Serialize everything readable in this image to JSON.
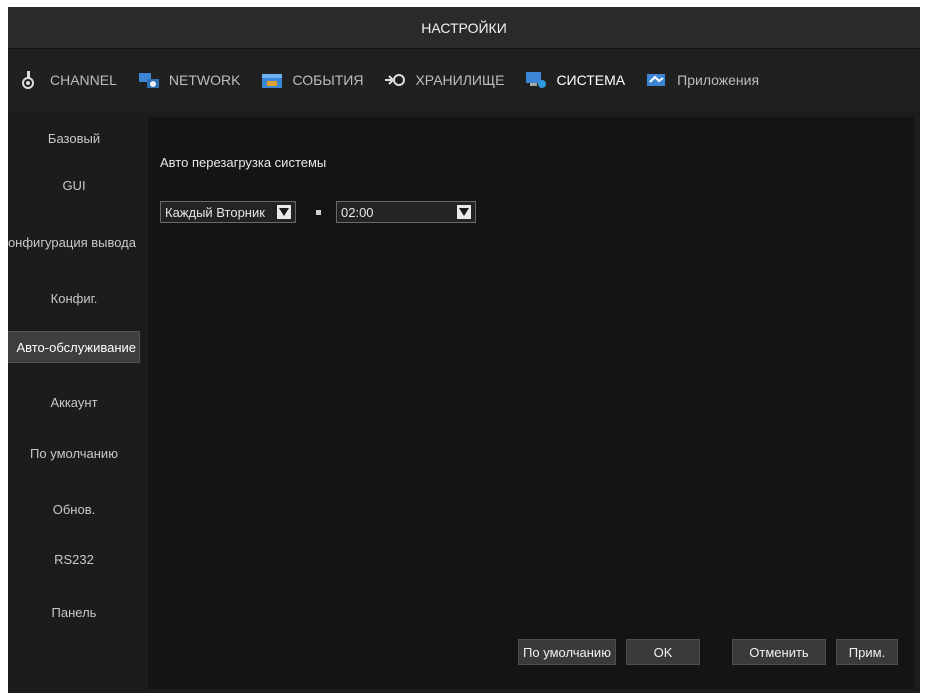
{
  "window": {
    "title": "НАСТРОЙКИ"
  },
  "tabs": [
    {
      "label": "CHANNEL",
      "icon": "camera-icon"
    },
    {
      "label": "NETWORK",
      "icon": "network-icon"
    },
    {
      "label": "СОБЫТИЯ",
      "icon": "events-icon"
    },
    {
      "label": "ХРАНИЛИЩЕ",
      "icon": "storage-icon"
    },
    {
      "label": "СИСТЕМА",
      "icon": "system-icon",
      "active": true
    },
    {
      "label": "Приложения",
      "icon": "apps-icon"
    }
  ],
  "sidebar": {
    "items": [
      {
        "label": "Базовый"
      },
      {
        "label": "GUI"
      },
      {
        "label": "Конфигурация вывода"
      },
      {
        "label": "Конфиг."
      },
      {
        "label": "Авто-обслуживание",
        "active": true
      },
      {
        "label": "Аккаунт"
      },
      {
        "label": "По умолчанию"
      },
      {
        "label": "Обнов."
      },
      {
        "label": "RS232"
      },
      {
        "label": "Панель"
      }
    ]
  },
  "content": {
    "title": "Авто перезагрузка системы",
    "day_select": "Каждый Вторник",
    "time_select": "02:00"
  },
  "buttons": {
    "default": "По умолчанию",
    "ok": "OK",
    "cancel": "Отменить",
    "apply": "Прим."
  },
  "colors": {
    "background": "#1c1c1c",
    "panel": "#141414",
    "active_item": "#3e3e3e",
    "text": "#c8c8c8"
  }
}
